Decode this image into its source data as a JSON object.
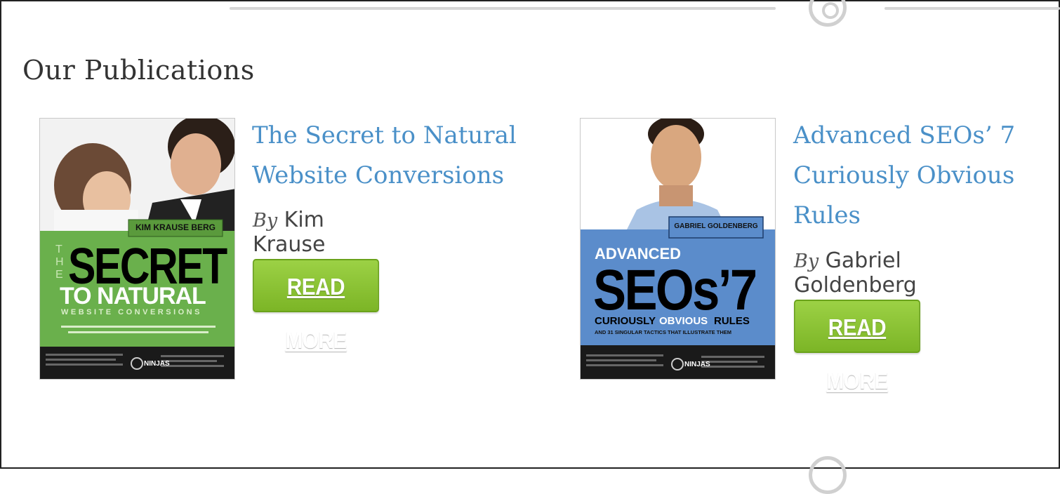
{
  "section": {
    "title": "Our Publications"
  },
  "publications": [
    {
      "title": "The Secret to Natural Website Conversions",
      "by_label": "By",
      "author": "Kim Krause Berg",
      "button_label": "READ MORE",
      "cover": {
        "author_tag": "KIM KRAUSE BERG",
        "line_the": "THE",
        "line_secret": "SECRET",
        "line_to_natural": "TO NATURAL",
        "line_website": "WEBSITE CONVERSIONS",
        "brand": "NINJAS",
        "bg_color": "#6ab04c",
        "footer_color": "#1a1a1a"
      }
    },
    {
      "title": "Advanced SEOs’ 7 Curiously Obvious Rules",
      "by_label": "By",
      "author": "Gabriel Goldenberg",
      "button_label": "READ MORE",
      "cover": {
        "author_tag": "GABRIEL GOLDENBERG",
        "line_advanced": "ADVANCED",
        "line_seos": "SEOs’7",
        "line_curiously": "CURIOUSLY",
        "line_obvious": "OBVIOUS",
        "line_rules": "RULES",
        "line_tactics": "AND 31 SINGULAR TACTICS THAT ILLUSTRATE THEM",
        "brand": "NINJAS",
        "bg_color": "#5b8ccb",
        "footer_color": "#1a1a1a"
      }
    }
  ],
  "colors": {
    "link": "#4a90c8",
    "button": "#8cc63f",
    "heading": "#333333"
  }
}
